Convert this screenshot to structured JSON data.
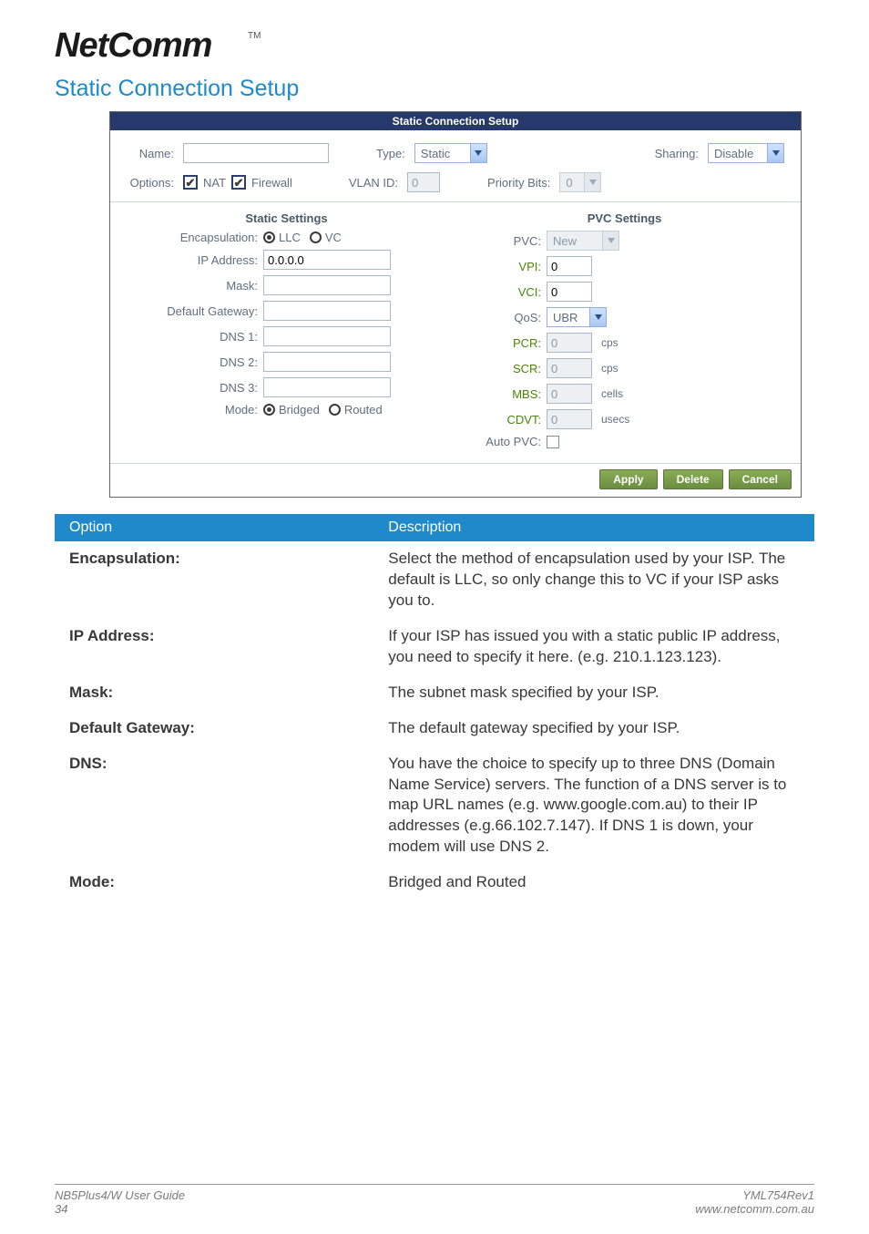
{
  "logo_brand": "NetComm",
  "section_title": "Static Connection Setup",
  "panel_title": "Static Connection Setup",
  "top": {
    "name_label": "Name:",
    "name_value": "",
    "type_label": "Type:",
    "type_value": "Static",
    "sharing_label": "Sharing:",
    "sharing_value": "Disable",
    "options_label": "Options:",
    "nat_label": "NAT",
    "firewall_label": "Firewall",
    "vlan_label": "VLAN ID:",
    "vlan_value": "0",
    "pbits_label": "Priority Bits:",
    "pbits_value": "0"
  },
  "static": {
    "heading": "Static Settings",
    "encaps_label": "Encapsulation:",
    "encaps_llc": "LLC",
    "encaps_vc": "VC",
    "ip_label": "IP Address:",
    "ip_value": "0.0.0.0",
    "mask_label": "Mask:",
    "mask_value": "",
    "gw_label": "Default Gateway:",
    "gw_value": "",
    "dns1_label": "DNS 1:",
    "dns1_value": "",
    "dns2_label": "DNS 2:",
    "dns2_value": "",
    "dns3_label": "DNS 3:",
    "dns3_value": "",
    "mode_label": "Mode:",
    "mode_bridged": "Bridged",
    "mode_routed": "Routed"
  },
  "pvc": {
    "heading": "PVC Settings",
    "pvc_label": "PVC:",
    "pvc_value": "New",
    "vpi_label": "VPI:",
    "vpi_value": "0",
    "vci_label": "VCI:",
    "vci_value": "0",
    "qos_label": "QoS:",
    "qos_value": "UBR",
    "pcr_label": "PCR:",
    "pcr_value": "0",
    "pcr_unit": "cps",
    "scr_label": "SCR:",
    "scr_value": "0",
    "scr_unit": "cps",
    "mbs_label": "MBS:",
    "mbs_value": "0",
    "mbs_unit": "cells",
    "cdvt_label": "CDVT:",
    "cdvt_value": "0",
    "cdvt_unit": "usecs",
    "auto_label": "Auto PVC:"
  },
  "buttons": {
    "apply": "Apply",
    "delete": "Delete",
    "cancel": "Cancel"
  },
  "table": {
    "head_option": "Option",
    "head_desc": "Description",
    "rows": [
      {
        "option": "Encapsulation:",
        "desc": "Select the method of encapsulation used by your ISP.  The default is LLC, so only change this to VC if your ISP asks you to."
      },
      {
        "option": "IP Address:",
        "desc": "If your ISP has issued you with a static public IP address, you need to specify it here. (e.g. 210.1.123.123)."
      },
      {
        "option": "Mask:",
        "desc": "The subnet mask specified by your ISP."
      },
      {
        "option": "Default Gateway:",
        "desc": "The default gateway specified by your ISP."
      },
      {
        "option": "DNS:",
        "desc": "You have the choice to specify up to three DNS (Domain Name Service) servers. The function of a DNS server is to map URL names (e.g. www.google.com.au) to their IP addresses (e.g.66.102.7.147). If DNS 1 is down, your modem will use DNS 2."
      },
      {
        "option": "Mode:",
        "desc": "Bridged and Routed"
      }
    ]
  },
  "footer": {
    "guide": "NB5Plus4/W User Guide",
    "page": "34",
    "rev": "YML754Rev1",
    "url": "www.netcomm.com.au"
  }
}
